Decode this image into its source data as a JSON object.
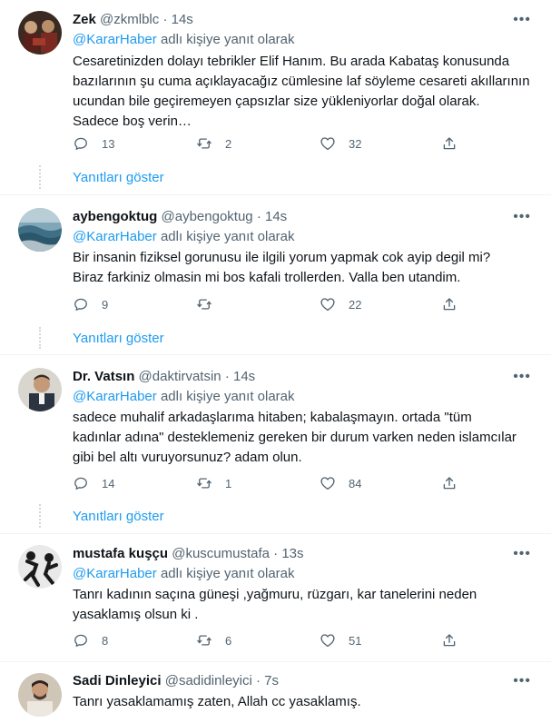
{
  "tweets": [
    {
      "name": "Zek",
      "handle": "@zkmlblc",
      "time": "14s",
      "reply_prefix": "@KararHaber",
      "reply_suffix": "adlı kişiye yanıt olarak",
      "lines": [
        "Cesaretinizden dolayı tebrikler Elif Hanım. Bu arada Kabataş konusunda",
        "bazılarının şu cuma açıklayacağız cümlesine laf söyleme cesareti akıllarının",
        "ucundan bile geçiremeyen çapsızlar size yükleniyorlar doğal olarak.",
        "Sadece boş verin…"
      ],
      "replies": "13",
      "retweets": "2",
      "likes": "32",
      "show_replies": "Yanıtları göster"
    },
    {
      "name": "aybengoktug",
      "handle": "@aybengoktug",
      "time": "14s",
      "reply_prefix": "@KararHaber",
      "reply_suffix": "adlı kişiye yanıt olarak",
      "lines": [
        "Bir insanin fiziksel gorunusu ile ilgili yorum yapmak cok ayip degil mi?",
        "Biraz farkiniz olmasin mi bos kafali trollerden. Valla ben utandim."
      ],
      "replies": "9",
      "retweets": "",
      "likes": "22",
      "show_replies": "Yanıtları göster"
    },
    {
      "name": "Dr. Vatsın",
      "handle": "@daktirvatsin",
      "time": "14s",
      "reply_prefix": "@KararHaber",
      "reply_suffix": "adlı kişiye yanıt olarak",
      "lines": [
        "sadece muhalif arkadaşlarıma hitaben; kabalaşmayın. ortada \"tüm",
        "kadınlar adına\" desteklemeniz gereken bir durum varken neden islamcılar",
        "gibi bel altı vuruyorsunuz? adam olun."
      ],
      "replies": "14",
      "retweets": "1",
      "likes": "84",
      "show_replies": "Yanıtları göster"
    },
    {
      "name": "mustafa kuşçu",
      "handle": "@kuscumustafa",
      "time": "13s",
      "reply_prefix": "@KararHaber",
      "reply_suffix": "adlı kişiye yanıt olarak",
      "lines": [
        "Tanrı kadının saçına güneşi ,yağmuru, rüzgarı, kar tanelerini neden",
        "yasaklamış olsun ki ."
      ],
      "replies": "8",
      "retweets": "6",
      "likes": "51"
    },
    {
      "name": "Sadi Dinleyici",
      "handle": "@sadidinleyici",
      "time": "7s",
      "lines": [
        "Tanrı yasaklamamış zaten, Allah cc yasaklamış."
      ]
    }
  ],
  "ui": {
    "dot": "·",
    "more": "•••"
  },
  "colors": {
    "accent": "#1d9bf0",
    "secondary_text": "#536471",
    "divider": "#eff3f4"
  }
}
